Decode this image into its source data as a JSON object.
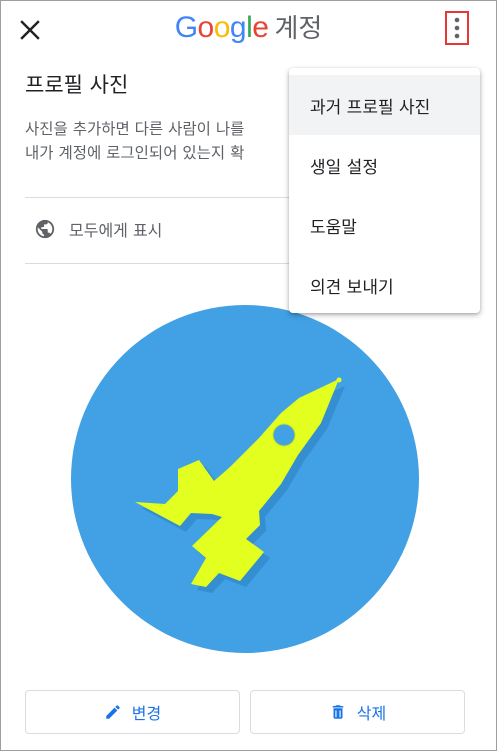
{
  "header": {
    "brand_letters": [
      "G",
      "o",
      "o",
      "g",
      "l",
      "e"
    ],
    "brand_colors": [
      "#4285F4",
      "#EA4335",
      "#FBBC05",
      "#4285F4",
      "#34A853",
      "#EA4335"
    ],
    "account_label": "계정",
    "close_icon": "close-icon",
    "more_icon": "more-vert-icon"
  },
  "main": {
    "title": "프로필 사진",
    "description_line1": "사진을 추가하면 다른 사람이 나를",
    "description_line2": "내가 계정에 로그인되어 있는지 확",
    "visibility_icon": "globe-icon",
    "visibility_label": "모두에게 표시",
    "avatar": {
      "icon": "rocket-icon",
      "circle_color": "#42A0E4",
      "rocket_color": "#E2FF1F"
    }
  },
  "actions": {
    "edit_label": "변경",
    "edit_icon": "pencil-icon",
    "delete_label": "삭제",
    "delete_icon": "trash-icon",
    "accent": "#1A73E8"
  },
  "menu": {
    "items": [
      {
        "label": "과거 프로필 사진",
        "highlighted": true
      },
      {
        "label": "생일 설정",
        "highlighted": false
      },
      {
        "label": "도움말",
        "highlighted": false
      },
      {
        "label": "의견 보내기",
        "highlighted": false
      }
    ]
  }
}
